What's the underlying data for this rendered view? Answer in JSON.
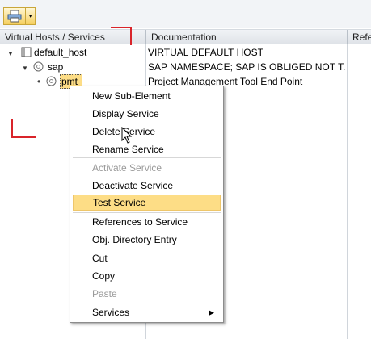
{
  "toolbar": {
    "icon": "print-icon",
    "dropdown": "▾"
  },
  "columns": {
    "services": "Virtual Hosts / Services",
    "documentation": "Documentation",
    "refe": "Refe"
  },
  "tree": [
    {
      "name": "default_host",
      "doc": "VIRTUAL DEFAULT HOST",
      "icon": "host-icon"
    },
    {
      "name": "sap",
      "doc": "SAP NAMESPACE; SAP IS OBLIGED NOT T...",
      "icon": "service-icon"
    },
    {
      "name": "pmt",
      "doc": "Project Management Tool End Point",
      "icon": "service-icon"
    }
  ],
  "context_menu": {
    "items": [
      {
        "label": "New Sub-Element",
        "disabled": false
      },
      {
        "label": "Display Service",
        "disabled": false
      },
      {
        "label": "Delete Service",
        "disabled": false
      },
      {
        "label": "Rename Service",
        "disabled": false
      },
      {
        "label": "Activate Service",
        "disabled": true
      },
      {
        "label": "Deactivate Service",
        "disabled": false
      },
      {
        "label": "Test Service",
        "disabled": false,
        "highlighted": true
      },
      {
        "label": "References to Service",
        "disabled": false
      },
      {
        "label": "Obj. Directory Entry",
        "disabled": false
      },
      {
        "label": "Cut",
        "disabled": false
      },
      {
        "label": "Copy",
        "disabled": false
      },
      {
        "label": "Paste",
        "disabled": true
      },
      {
        "label": "Services",
        "disabled": false,
        "submenu": "▶"
      }
    ]
  }
}
